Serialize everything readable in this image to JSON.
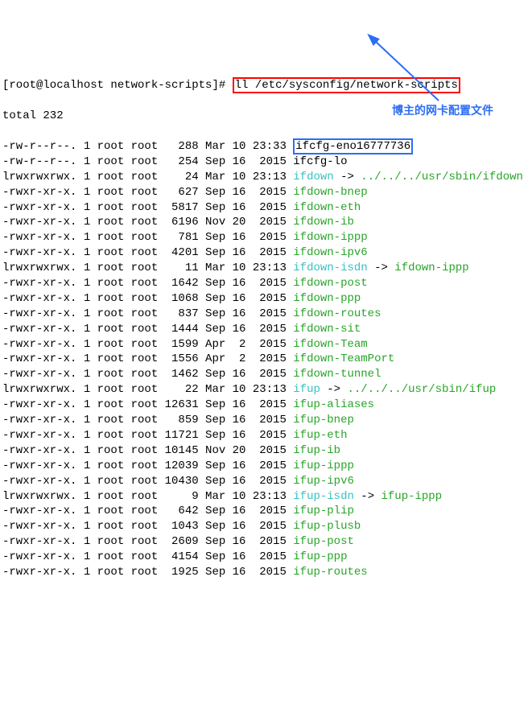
{
  "prompt": {
    "user_host": "[root@localhost network-scripts]# ",
    "command": "ll /etc/sysconfig/network-scripts"
  },
  "total_line": "total 232",
  "highlighted_file": "ifcfg-eno16777736",
  "annotation_text": "博主的网卡配置文件",
  "files": [
    {
      "perm": "-rw-r--r--.",
      "links": "1",
      "owner": "root",
      "group": "root",
      "size": "  288",
      "date": "Mar 10 23:33",
      "name": "ifcfg-eno16777736",
      "color": "black",
      "highlighted": true
    },
    {
      "perm": "-rw-r--r--.",
      "links": "1",
      "owner": "root",
      "group": "root",
      "size": "  254",
      "date": "Sep 16  2015",
      "name": "ifcfg-lo",
      "color": "black"
    },
    {
      "perm": "lrwxrwxrwx.",
      "links": "1",
      "owner": "root",
      "group": "root",
      "size": "   24",
      "date": "Mar 10 23:13",
      "name": "ifdown",
      "color": "cyan",
      "link_target": " -> ../../../usr/sbin/ifdown",
      "target_color": "green"
    },
    {
      "perm": "-rwxr-xr-x.",
      "links": "1",
      "owner": "root",
      "group": "root",
      "size": "  627",
      "date": "Sep 16  2015",
      "name": "ifdown-bnep",
      "color": "green"
    },
    {
      "perm": "-rwxr-xr-x.",
      "links": "1",
      "owner": "root",
      "group": "root",
      "size": " 5817",
      "date": "Sep 16  2015",
      "name": "ifdown-eth",
      "color": "green"
    },
    {
      "perm": "-rwxr-xr-x.",
      "links": "1",
      "owner": "root",
      "group": "root",
      "size": " 6196",
      "date": "Nov 20  2015",
      "name": "ifdown-ib",
      "color": "green"
    },
    {
      "perm": "-rwxr-xr-x.",
      "links": "1",
      "owner": "root",
      "group": "root",
      "size": "  781",
      "date": "Sep 16  2015",
      "name": "ifdown-ippp",
      "color": "green"
    },
    {
      "perm": "-rwxr-xr-x.",
      "links": "1",
      "owner": "root",
      "group": "root",
      "size": " 4201",
      "date": "Sep 16  2015",
      "name": "ifdown-ipv6",
      "color": "green"
    },
    {
      "perm": "lrwxrwxrwx.",
      "links": "1",
      "owner": "root",
      "group": "root",
      "size": "   11",
      "date": "Mar 10 23:13",
      "name": "ifdown-isdn",
      "color": "cyan",
      "link_target": " -> ifdown-ippp",
      "target_color": "green"
    },
    {
      "perm": "-rwxr-xr-x.",
      "links": "1",
      "owner": "root",
      "group": "root",
      "size": " 1642",
      "date": "Sep 16  2015",
      "name": "ifdown-post",
      "color": "green"
    },
    {
      "perm": "-rwxr-xr-x.",
      "links": "1",
      "owner": "root",
      "group": "root",
      "size": " 1068",
      "date": "Sep 16  2015",
      "name": "ifdown-ppp",
      "color": "green"
    },
    {
      "perm": "-rwxr-xr-x.",
      "links": "1",
      "owner": "root",
      "group": "root",
      "size": "  837",
      "date": "Sep 16  2015",
      "name": "ifdown-routes",
      "color": "green"
    },
    {
      "perm": "-rwxr-xr-x.",
      "links": "1",
      "owner": "root",
      "group": "root",
      "size": " 1444",
      "date": "Sep 16  2015",
      "name": "ifdown-sit",
      "color": "green"
    },
    {
      "perm": "-rwxr-xr-x.",
      "links": "1",
      "owner": "root",
      "group": "root",
      "size": " 1599",
      "date": "Apr  2  2015",
      "name": "ifdown-Team",
      "color": "green"
    },
    {
      "perm": "-rwxr-xr-x.",
      "links": "1",
      "owner": "root",
      "group": "root",
      "size": " 1556",
      "date": "Apr  2  2015",
      "name": "ifdown-TeamPort",
      "color": "green"
    },
    {
      "perm": "-rwxr-xr-x.",
      "links": "1",
      "owner": "root",
      "group": "root",
      "size": " 1462",
      "date": "Sep 16  2015",
      "name": "ifdown-tunnel",
      "color": "green"
    },
    {
      "perm": "lrwxrwxrwx.",
      "links": "1",
      "owner": "root",
      "group": "root",
      "size": "   22",
      "date": "Mar 10 23:13",
      "name": "ifup",
      "color": "cyan",
      "link_target": " -> ../../../usr/sbin/ifup",
      "target_color": "green"
    },
    {
      "perm": "-rwxr-xr-x.",
      "links": "1",
      "owner": "root",
      "group": "root",
      "size": "12631",
      "date": "Sep 16  2015",
      "name": "ifup-aliases",
      "color": "green"
    },
    {
      "perm": "-rwxr-xr-x.",
      "links": "1",
      "owner": "root",
      "group": "root",
      "size": "  859",
      "date": "Sep 16  2015",
      "name": "ifup-bnep",
      "color": "green"
    },
    {
      "perm": "-rwxr-xr-x.",
      "links": "1",
      "owner": "root",
      "group": "root",
      "size": "11721",
      "date": "Sep 16  2015",
      "name": "ifup-eth",
      "color": "green"
    },
    {
      "perm": "-rwxr-xr-x.",
      "links": "1",
      "owner": "root",
      "group": "root",
      "size": "10145",
      "date": "Nov 20  2015",
      "name": "ifup-ib",
      "color": "green"
    },
    {
      "perm": "-rwxr-xr-x.",
      "links": "1",
      "owner": "root",
      "group": "root",
      "size": "12039",
      "date": "Sep 16  2015",
      "name": "ifup-ippp",
      "color": "green"
    },
    {
      "perm": "-rwxr-xr-x.",
      "links": "1",
      "owner": "root",
      "group": "root",
      "size": "10430",
      "date": "Sep 16  2015",
      "name": "ifup-ipv6",
      "color": "green"
    },
    {
      "perm": "lrwxrwxrwx.",
      "links": "1",
      "owner": "root",
      "group": "root",
      "size": "    9",
      "date": "Mar 10 23:13",
      "name": "ifup-isdn",
      "color": "cyan",
      "link_target": " -> ifup-ippp",
      "target_color": "green"
    },
    {
      "perm": "-rwxr-xr-x.",
      "links": "1",
      "owner": "root",
      "group": "root",
      "size": "  642",
      "date": "Sep 16  2015",
      "name": "ifup-plip",
      "color": "green"
    },
    {
      "perm": "-rwxr-xr-x.",
      "links": "1",
      "owner": "root",
      "group": "root",
      "size": " 1043",
      "date": "Sep 16  2015",
      "name": "ifup-plusb",
      "color": "green"
    },
    {
      "perm": "-rwxr-xr-x.",
      "links": "1",
      "owner": "root",
      "group": "root",
      "size": " 2609",
      "date": "Sep 16  2015",
      "name": "ifup-post",
      "color": "green"
    },
    {
      "perm": "-rwxr-xr-x.",
      "links": "1",
      "owner": "root",
      "group": "root",
      "size": " 4154",
      "date": "Sep 16  2015",
      "name": "ifup-ppp",
      "color": "green"
    },
    {
      "perm": "-rwxr-xr-x.",
      "links": "1",
      "owner": "root",
      "group": "root",
      "size": " 1925",
      "date": "Sep 16  2015",
      "name": "ifup-routes",
      "color": "green"
    }
  ]
}
